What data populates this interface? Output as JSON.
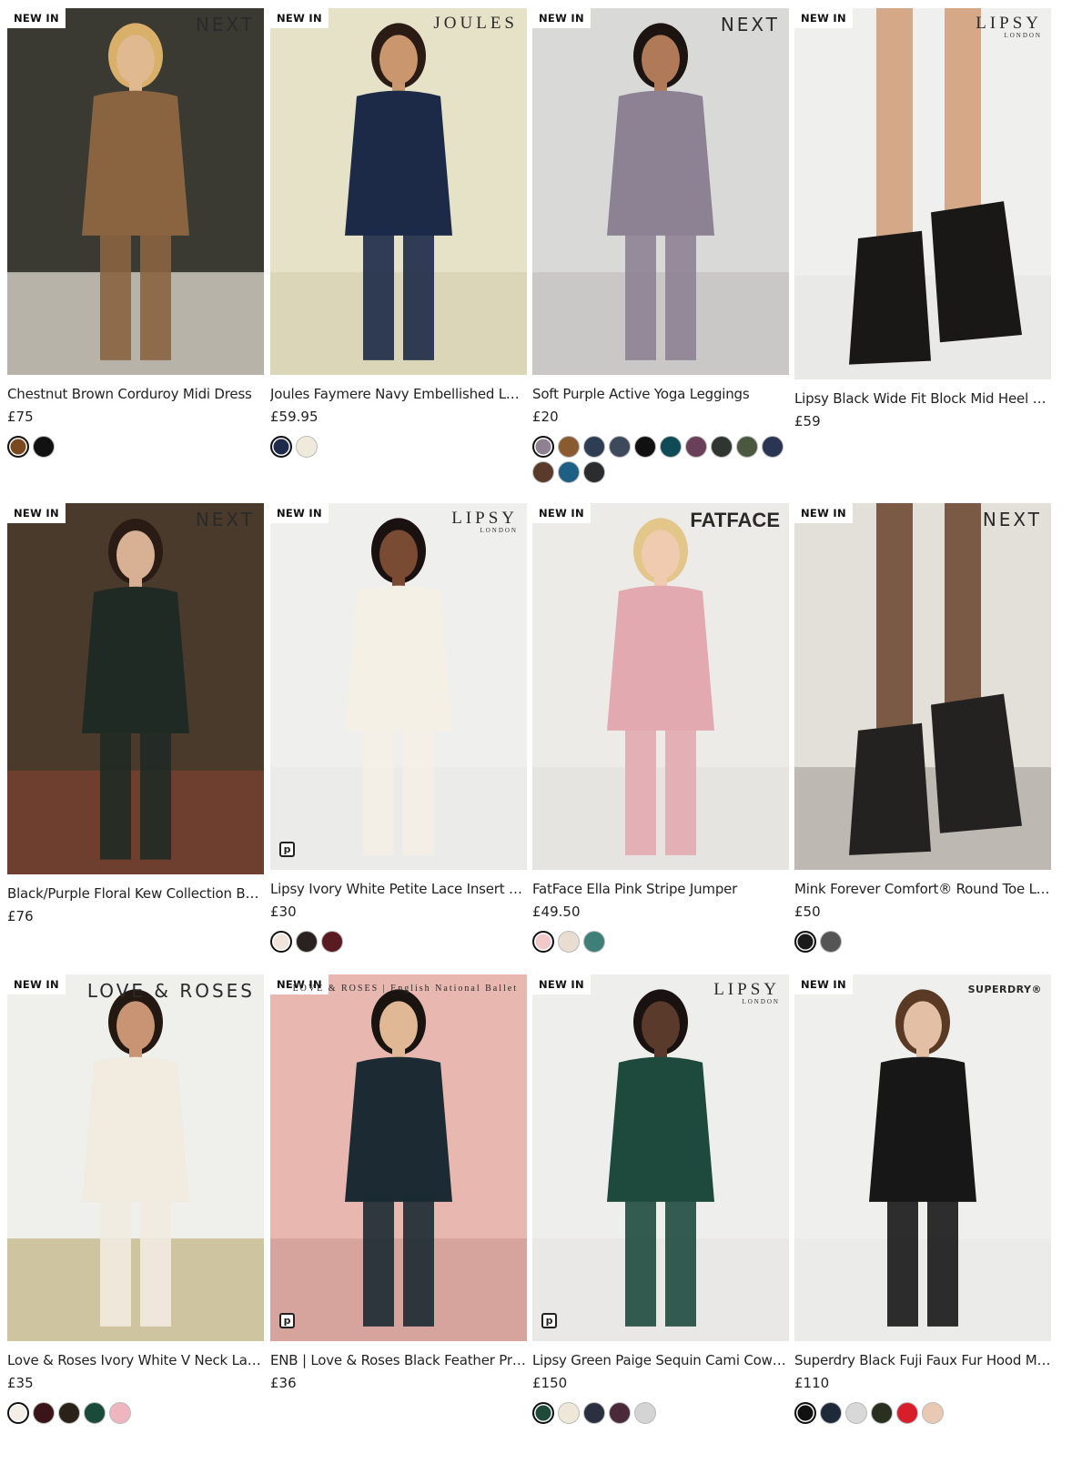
{
  "products": [
    {
      "badge": "NEW IN",
      "brand": "NEXT",
      "brand_sub": "",
      "title": "Chestnut Brown Corduroy Midi Dress",
      "price": "£75",
      "image": {
        "bg": "#3b3a32",
        "floor": "#b8b3a8",
        "garment": "#8a6440",
        "skin": "#e0b990",
        "hair": "#d9b06a"
      },
      "swatches": [
        "#7a4a1e",
        "#111111"
      ],
      "pay_icon": false
    },
    {
      "badge": "NEW IN",
      "brand": "JOULES",
      "brand_sub": "",
      "title": "Joules Faymere Navy Embellished Long Sleeve Top",
      "price": "£59.95",
      "image": {
        "bg": "#e6e2c8",
        "floor": "#dcd6b8",
        "garment": "#1c2a48",
        "skin": "#c9966d",
        "hair": "#2a1c14"
      },
      "swatches": [
        "#1e2b4a",
        "#efeadb"
      ],
      "pay_icon": false
    },
    {
      "badge": "NEW IN",
      "brand": "NEXT",
      "brand_sub": "",
      "title": "Soft Purple Active Yoga Leggings",
      "price": "£20",
      "image": {
        "bg": "#d9d9d7",
        "floor": "#c9c8c6",
        "garment": "#8d8293",
        "skin": "#b07a58",
        "hair": "#1c1410"
      },
      "swatches": [
        "#8e8292",
        "#8a5a30",
        "#2d3d52",
        "#3c4a5c",
        "#111111",
        "#0f4a57",
        "#6a3f58",
        "#2f3530",
        "#4a5840",
        "#2a3554",
        "#5a3a2a",
        "#1e5f86",
        "#2a2c2e"
      ],
      "pay_icon": false
    },
    {
      "badge": "NEW IN",
      "brand": "LIPSY",
      "brand_sub": "LONDON",
      "title": "Lipsy Black Wide Fit Block Mid Heel Ankle Boot",
      "price": "£59",
      "image": {
        "bg": "#efefee",
        "floor": "#e9e9e7",
        "garment": "#1a1817",
        "skin": "#d5a888",
        "hair": "#d5a888"
      },
      "swatches": [],
      "pay_icon": false
    },
    {
      "badge": "NEW IN",
      "brand": "NEXT",
      "brand_sub": "",
      "title": "Black/Purple Floral Kew Collection Bardot Maxi Dress",
      "price": "£76",
      "image": {
        "bg": "#4a3a2c",
        "floor": "#6e3e2e",
        "garment": "#1f2a24",
        "skin": "#d8b094",
        "hair": "#2a1c14"
      },
      "swatches": [],
      "pay_icon": false
    },
    {
      "badge": "NEW IN",
      "brand": "LIPSY",
      "brand_sub": "LONDON",
      "title": "Lipsy Ivory White Petite Lace Insert Knitted Jumper",
      "price": "£30",
      "image": {
        "bg": "#efefed",
        "floor": "#ebebe9",
        "garment": "#f4f0e6",
        "skin": "#7a4b33",
        "hair": "#1a1210"
      },
      "swatches": [
        "#f1e4da",
        "#2a2220",
        "#5a1a22"
      ],
      "pay_icon": true
    },
    {
      "badge": "NEW IN",
      "brand": "FATFACE",
      "brand_sub": "",
      "title": "FatFace Ella Pink Stripe Jumper",
      "price": "£49.50",
      "image": {
        "bg": "#ecebe8",
        "floor": "#e6e4e1",
        "garment": "#e2aab0",
        "skin": "#f0cbb0",
        "hair": "#e3c68a"
      },
      "swatches": [
        "#f2c8c8",
        "#e8ddd0",
        "#3e7f78"
      ],
      "pay_icon": false
    },
    {
      "badge": "NEW IN",
      "brand": "NEXT",
      "brand_sub": "",
      "title": "Mink Forever Comfort® Round Toe Loafers",
      "price": "£50",
      "image": {
        "bg": "#e3dfd9",
        "floor": "#bdb8b2",
        "garment": "#242220",
        "skin": "#7a5a45",
        "hair": "#7a5a45"
      },
      "swatches": [
        "#1a1a1a",
        "#555555"
      ],
      "pay_icon": false
    },
    {
      "badge": "NEW IN",
      "brand": "LOVE & ROSES",
      "brand_sub": "",
      "title": "Love & Roses Ivory White V Neck Lace Trim Blouse",
      "price": "£35",
      "image": {
        "bg": "#efefec",
        "floor": "#cfc4a0",
        "garment": "#f1ebe0",
        "skin": "#c89474",
        "hair": "#231812"
      },
      "swatches": [
        "#f4efe6",
        "#3a1418",
        "#2a2218",
        "#1c4a3a",
        "#f0b6c0"
      ],
      "pay_icon": false
    },
    {
      "badge": "NEW IN",
      "brand": "LOVE & ROSES | English National Ballet",
      "brand_sub": "",
      "title": "ENB | Love & Roses Black Feather Print Short Sleeve Top",
      "price": "£36",
      "image": {
        "bg": "#e8b8b0",
        "floor": "#d6a49c",
        "garment": "#1b2a33",
        "skin": "#e1b895",
        "hair": "#1a1410"
      },
      "swatches": [],
      "pay_icon": true
    },
    {
      "badge": "NEW IN",
      "brand": "LIPSY",
      "brand_sub": "LONDON",
      "title": "Lipsy Green Paige Sequin Cami Cowl Neck Maxi Dress",
      "price": "£150",
      "image": {
        "bg": "#eeeeec",
        "floor": "#e9e8e6",
        "garment": "#1e4a3e",
        "skin": "#5a3a2a",
        "hair": "#1a1210"
      },
      "swatches": [
        "#1f4a3a",
        "#efe8d8",
        "#2a3040",
        "#4a2a3a",
        "#d4d4d4"
      ],
      "pay_icon": true
    },
    {
      "badge": "NEW IN",
      "brand": "SUPERDRY®",
      "brand_sub": "",
      "title": "Superdry Black Fuji Faux Fur Hood Mid Length Puffer Coat",
      "price": "£110",
      "image": {
        "bg": "#efefee",
        "floor": "#ebebea",
        "garment": "#171717",
        "skin": "#e2bfa5",
        "hair": "#5a3a24"
      },
      "swatches": [
        "#111111",
        "#1e2a3a",
        "#d8d8d8",
        "#2a3020",
        "#d81e2a",
        "#e9c9b4"
      ],
      "pay_icon": false
    }
  ]
}
